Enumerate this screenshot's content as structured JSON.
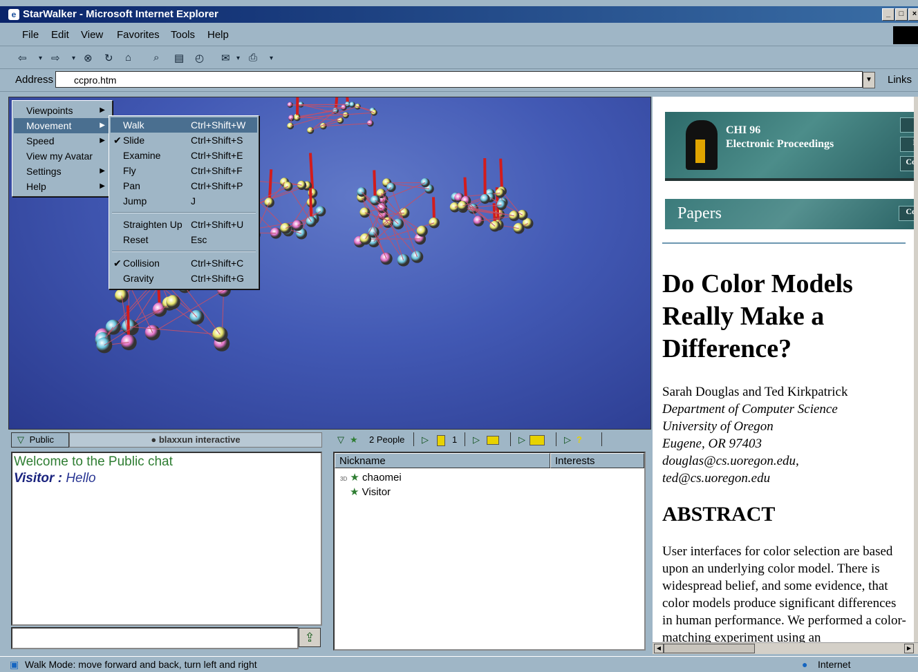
{
  "window": {
    "title": "StarWalker - Microsoft Internet Explorer",
    "min": "_",
    "max": "×"
  },
  "menubar": [
    "File",
    "Edit",
    "View",
    "Favorites",
    "Tools",
    "Help"
  ],
  "toolbar": {
    "back": "⇦",
    "forward": "⇨",
    "stop": "⊗",
    "refresh": "↻",
    "home": "⌂",
    "search": "⌕",
    "favorites": "▤",
    "history": "◴",
    "mail": "✉",
    "print": "⎙",
    "dropdown": "▾"
  },
  "address": {
    "label": "Address",
    "value": "ccpro.htm",
    "links": "Links"
  },
  "context_menu": {
    "items": [
      {
        "label": "Viewpoints",
        "arrow": "▶"
      },
      {
        "label": "Movement",
        "arrow": "▶"
      },
      {
        "label": "Speed",
        "arrow": "▶"
      },
      {
        "label": "View my Avatar",
        "arrow": ""
      },
      {
        "label": "Settings",
        "arrow": "▶"
      },
      {
        "label": "Help",
        "arrow": "▶"
      }
    ]
  },
  "movement_menu": {
    "items": [
      {
        "label": "Walk",
        "shortcut": "Ctrl+Shift+W",
        "check": ""
      },
      {
        "label": "Slide",
        "shortcut": "Ctrl+Shift+S",
        "check": "✔"
      },
      {
        "label": "Examine",
        "shortcut": "Ctrl+Shift+E",
        "check": ""
      },
      {
        "label": "Fly",
        "shortcut": "Ctrl+Shift+F",
        "check": ""
      },
      {
        "label": "Pan",
        "shortcut": "Ctrl+Shift+P",
        "check": ""
      },
      {
        "label": "Jump",
        "shortcut": "J",
        "check": ""
      },
      {
        "label": "Straighten Up",
        "shortcut": "Ctrl+Shift+U",
        "check": ""
      },
      {
        "label": "Reset",
        "shortcut": "Esc",
        "check": ""
      },
      {
        "label": "Collision",
        "shortcut": "Ctrl+Shift+C",
        "check": "✔"
      },
      {
        "label": "Gravity",
        "shortcut": "Ctrl+Shift+G",
        "check": ""
      }
    ]
  },
  "chat": {
    "tab": "Public",
    "tab_arrow": "▽",
    "brand": "blaxxun interactive",
    "welcome": "Welcome to the Public chat",
    "messages": [
      {
        "user": "Visitor :",
        "text": "Hello"
      }
    ],
    "send_icon": "⇪"
  },
  "people": {
    "count_label": "2 People",
    "counter": "1",
    "columns": [
      "Nickname",
      "Interests"
    ],
    "rows": [
      {
        "name": "chaomei",
        "tag": "3D"
      },
      {
        "name": "Visitor",
        "tag": ""
      }
    ]
  },
  "webpage": {
    "banner_title": "CHI 96",
    "banner_sub": "Electronic Proceedings",
    "banner_btns": [
      "",
      "I",
      "Co"
    ],
    "section": "Papers",
    "section_btn": "Co",
    "title": "Do Color Models Really Make a Difference?",
    "authors": "Sarah Douglas and Ted Kirkpatrick",
    "dept": "Department of Computer Science",
    "univ": "University of Oregon",
    "city": "Eugene, OR 97403",
    "email1": "douglas@cs.uoregon.edu,",
    "email2": "ted@cs.uoregon.edu",
    "abstract_heading": "ABSTRACT",
    "abstract": "User interfaces for color selection are based upon an underlying color model. There is widespread belief, and some evidence, that color models produce significant differences in human performance. We performed a color- matching experiment using an"
  },
  "status": {
    "text": "Walk Mode: move forward and back, turn left and right",
    "zone": "Internet"
  }
}
